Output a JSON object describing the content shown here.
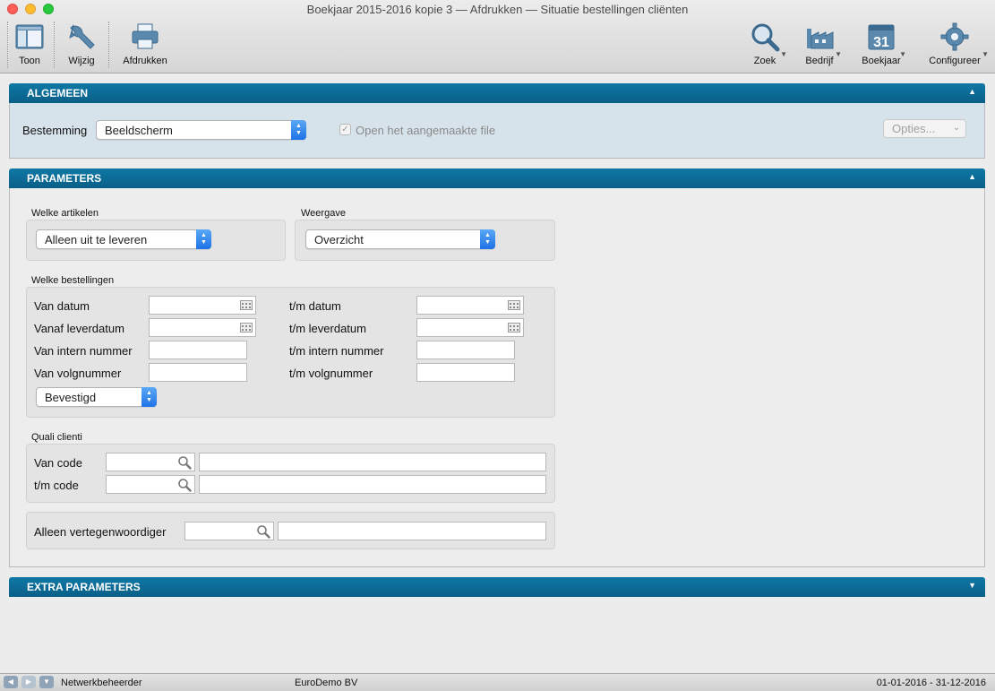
{
  "window": {
    "title": "Boekjaar 2015-2016 kopie 3 — Afdrukken — Situatie bestellingen cliënten"
  },
  "toolbar": {
    "left": [
      {
        "label": "Toon",
        "icon": "view-icon"
      },
      {
        "label": "Wijzig",
        "icon": "wrench-icon"
      },
      {
        "label": "Afdrukken",
        "icon": "printer-icon"
      }
    ],
    "right": [
      {
        "label": "Zoek",
        "icon": "magnifier-icon"
      },
      {
        "label": "Bedrijf",
        "icon": "factory-icon"
      },
      {
        "label": "Boekjaar",
        "icon": "calendar-icon",
        "calendar_day": "31"
      },
      {
        "label": "Configureer",
        "icon": "gear-icon"
      }
    ]
  },
  "algemeen": {
    "header": "ALGEMEEN",
    "bestemming_label": "Bestemming",
    "bestemming_value": "Beeldscherm",
    "open_file_label": "Open het aangemaakte file",
    "open_file_checked": true,
    "opties_label": "Opties..."
  },
  "parameters": {
    "header": "PARAMETERS",
    "welke_artikelen_label": "Welke artikelen",
    "welke_artikelen_value": "Alleen uit te leveren",
    "weergave_label": "Weergave",
    "weergave_value": "Overzicht",
    "welke_bestellingen_label": "Welke bestellingen",
    "rows": {
      "van_datum": "Van datum",
      "tm_datum": "t/m datum",
      "vanaf_leverdatum": "Vanaf leverdatum",
      "tm_leverdatum": "t/m leverdatum",
      "van_intern_nummer": "Van intern nummer",
      "tm_intern_nummer": "t/m intern nummer",
      "van_volgnummer": "Van volgnummer",
      "tm_volgnummer": "t/m volgnummer"
    },
    "status_value": "Bevestigd",
    "quali_clienti_label": "Quali clienti",
    "van_code": "Van code",
    "tm_code": "t/m code",
    "vertegenwoordiger_label": "Alleen vertegenwoordiger"
  },
  "extra": {
    "header": "EXTRA PARAMETERS"
  },
  "statusbar": {
    "user": "Netwerkbeheerder",
    "company": "EuroDemo BV",
    "period": "01-01-2016 - 31-12-2016"
  },
  "colors": {
    "section_header": "#0a6d99",
    "algemeen_bg": "#d7e3ea",
    "select_accent": "#1f72e6"
  }
}
